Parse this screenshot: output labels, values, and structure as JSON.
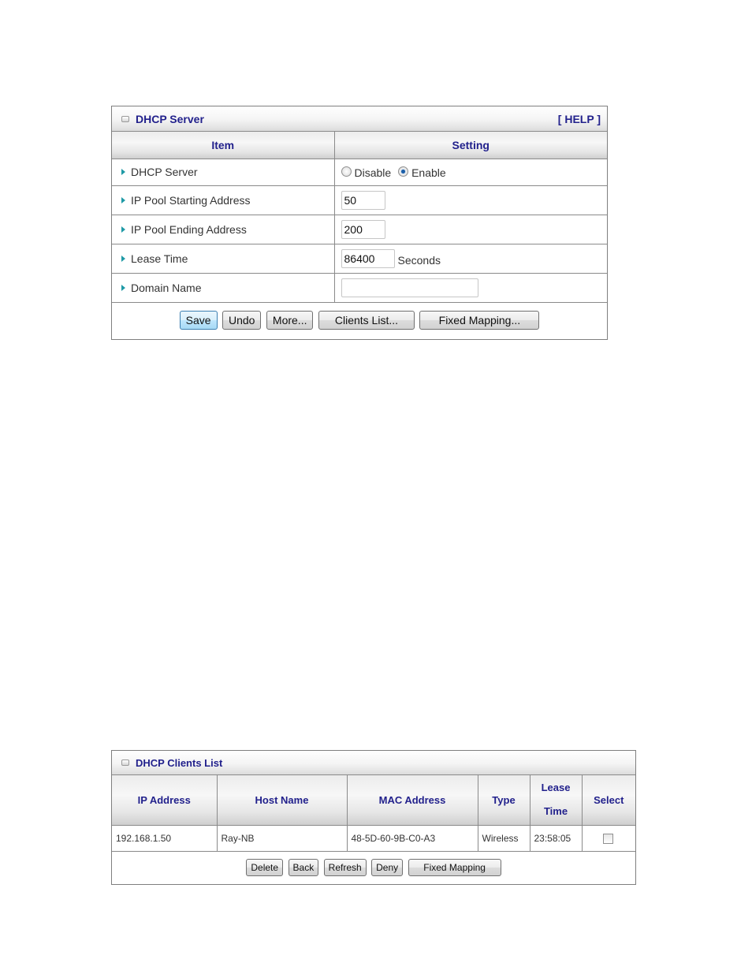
{
  "server_panel": {
    "title": "DHCP Server",
    "help_label": "[ HELP ]",
    "columns": {
      "item": "Item",
      "setting": "Setting"
    },
    "rows": {
      "dhcp_server": {
        "label": "DHCP Server",
        "options": [
          "Disable",
          "Enable"
        ],
        "selected": "Enable"
      },
      "pool_start": {
        "label": "IP Pool Starting Address",
        "value": "50"
      },
      "pool_end": {
        "label": "IP Pool Ending Address",
        "value": "200"
      },
      "lease_time": {
        "label": "Lease Time",
        "value": "86400",
        "unit": "Seconds"
      },
      "domain_name": {
        "label": "Domain Name",
        "value": ""
      }
    },
    "buttons": {
      "save": "Save",
      "undo": "Undo",
      "more": "More...",
      "clients_list": "Clients List...",
      "fixed_mapping": "Fixed Mapping..."
    }
  },
  "clients_panel": {
    "title": "DHCP Clients List",
    "columns": {
      "ip": "IP Address",
      "host": "Host Name",
      "mac": "MAC Address",
      "type": "Type",
      "lease_line1": "Lease",
      "lease_line2": "Time",
      "select": "Select"
    },
    "rows": [
      {
        "ip": "192.168.1.50",
        "host": "Ray-NB",
        "mac": "48-5D-60-9B-C0-A3",
        "type": "Wireless",
        "lease": "23:58:05",
        "selected": false
      }
    ],
    "buttons": {
      "delete": "Delete",
      "back": "Back",
      "refresh": "Refresh",
      "deny": "Deny",
      "fixed_mapping": "Fixed Mapping"
    }
  },
  "colors": {
    "heading_text": "#22218c",
    "bullet": "#1f9aa6",
    "border": "#8a8a8a"
  }
}
